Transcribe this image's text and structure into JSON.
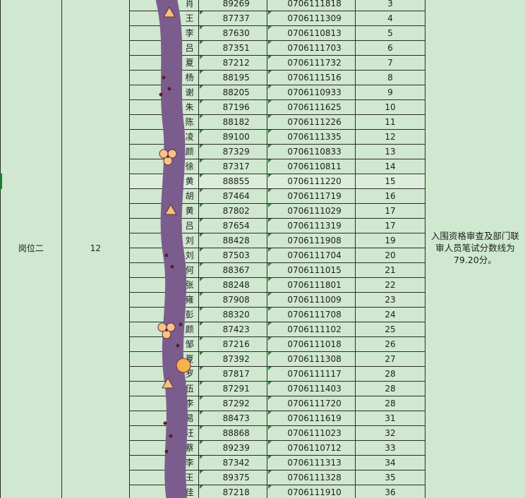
{
  "sheet": {
    "position_label": "岗位二",
    "position_count": "12",
    "note": "入围资格审查及部门联审人员笔试分数线为79.20分。",
    "accent_color": "#2e7d32",
    "background_color": "#cfe8cf",
    "rows": [
      {
        "name": "肖",
        "score": "89269",
        "ticket": "0706111818",
        "rank": "3"
      },
      {
        "name": "王",
        "score": "87737",
        "ticket": "0706111309",
        "rank": "4"
      },
      {
        "name": "李",
        "score": "87630",
        "ticket": "0706110813",
        "rank": "5"
      },
      {
        "name": "吕",
        "score": "87351",
        "ticket": "0706111703",
        "rank": "6"
      },
      {
        "name": "夏",
        "score": "87212",
        "ticket": "0706111732",
        "rank": "7"
      },
      {
        "name": "杨",
        "score": "88195",
        "ticket": "0706111516",
        "rank": "8"
      },
      {
        "name": "谢",
        "score": "88205",
        "ticket": "0706110933",
        "rank": "9"
      },
      {
        "name": "朱",
        "score": "87196",
        "ticket": "0706111625",
        "rank": "10"
      },
      {
        "name": "陈",
        "score": "88182",
        "ticket": "0706111226",
        "rank": "11"
      },
      {
        "name": "凌",
        "score": "89100",
        "ticket": "0706111335",
        "rank": "12"
      },
      {
        "name": "颜",
        "score": "87329",
        "ticket": "0706110833",
        "rank": "13"
      },
      {
        "name": "徐",
        "score": "87317",
        "ticket": "0706110811",
        "rank": "14"
      },
      {
        "name": "黄",
        "score": "88855",
        "ticket": "0706111220",
        "rank": "15"
      },
      {
        "name": "胡",
        "score": "87464",
        "ticket": "0706111719",
        "rank": "16"
      },
      {
        "name": "黄",
        "score": "87802",
        "ticket": "0706111029",
        "rank": "17"
      },
      {
        "name": "吕",
        "score": "87654",
        "ticket": "0706111319",
        "rank": "17"
      },
      {
        "name": "刘",
        "score": "88428",
        "ticket": "0706111908",
        "rank": "19"
      },
      {
        "name": "刘",
        "score": "87503",
        "ticket": "0706111704",
        "rank": "20"
      },
      {
        "name": "何",
        "score": "88367",
        "ticket": "0706111015",
        "rank": "21"
      },
      {
        "name": "张",
        "score": "88248",
        "ticket": "0706111801",
        "rank": "22"
      },
      {
        "name": "雍",
        "score": "87908",
        "ticket": "0706111009",
        "rank": "23"
      },
      {
        "name": "彭",
        "score": "88320",
        "ticket": "0706111708",
        "rank": "24"
      },
      {
        "name": "颜",
        "score": "87423",
        "ticket": "0706111102",
        "rank": "25"
      },
      {
        "name": "邹",
        "score": "87216",
        "ticket": "0706111018",
        "rank": "26"
      },
      {
        "name": "夏",
        "score": "87392",
        "ticket": "0706111308",
        "rank": "27"
      },
      {
        "name": "罗",
        "score": "87817",
        "ticket": "0706111117",
        "rank": "28"
      },
      {
        "name": "伍",
        "score": "87291",
        "ticket": "0706111403",
        "rank": "28"
      },
      {
        "name": "李",
        "score": "87292",
        "ticket": "0706111720",
        "rank": "28"
      },
      {
        "name": "易",
        "score": "88473",
        "ticket": "0706111619",
        "rank": "31"
      },
      {
        "name": "汪",
        "score": "88868",
        "ticket": "0706111023",
        "rank": "32"
      },
      {
        "name": "蔡",
        "score": "89239",
        "ticket": "0706110712",
        "rank": "33"
      },
      {
        "name": "李",
        "score": "87342",
        "ticket": "0706111313",
        "rank": "34"
      },
      {
        "name": "王",
        "score": "89375",
        "ticket": "0706111328",
        "rank": "35"
      },
      {
        "name": "黄佳",
        "score": "87218",
        "ticket": "0706111910",
        "rank": "36"
      }
    ],
    "highlighted_row": 12
  }
}
